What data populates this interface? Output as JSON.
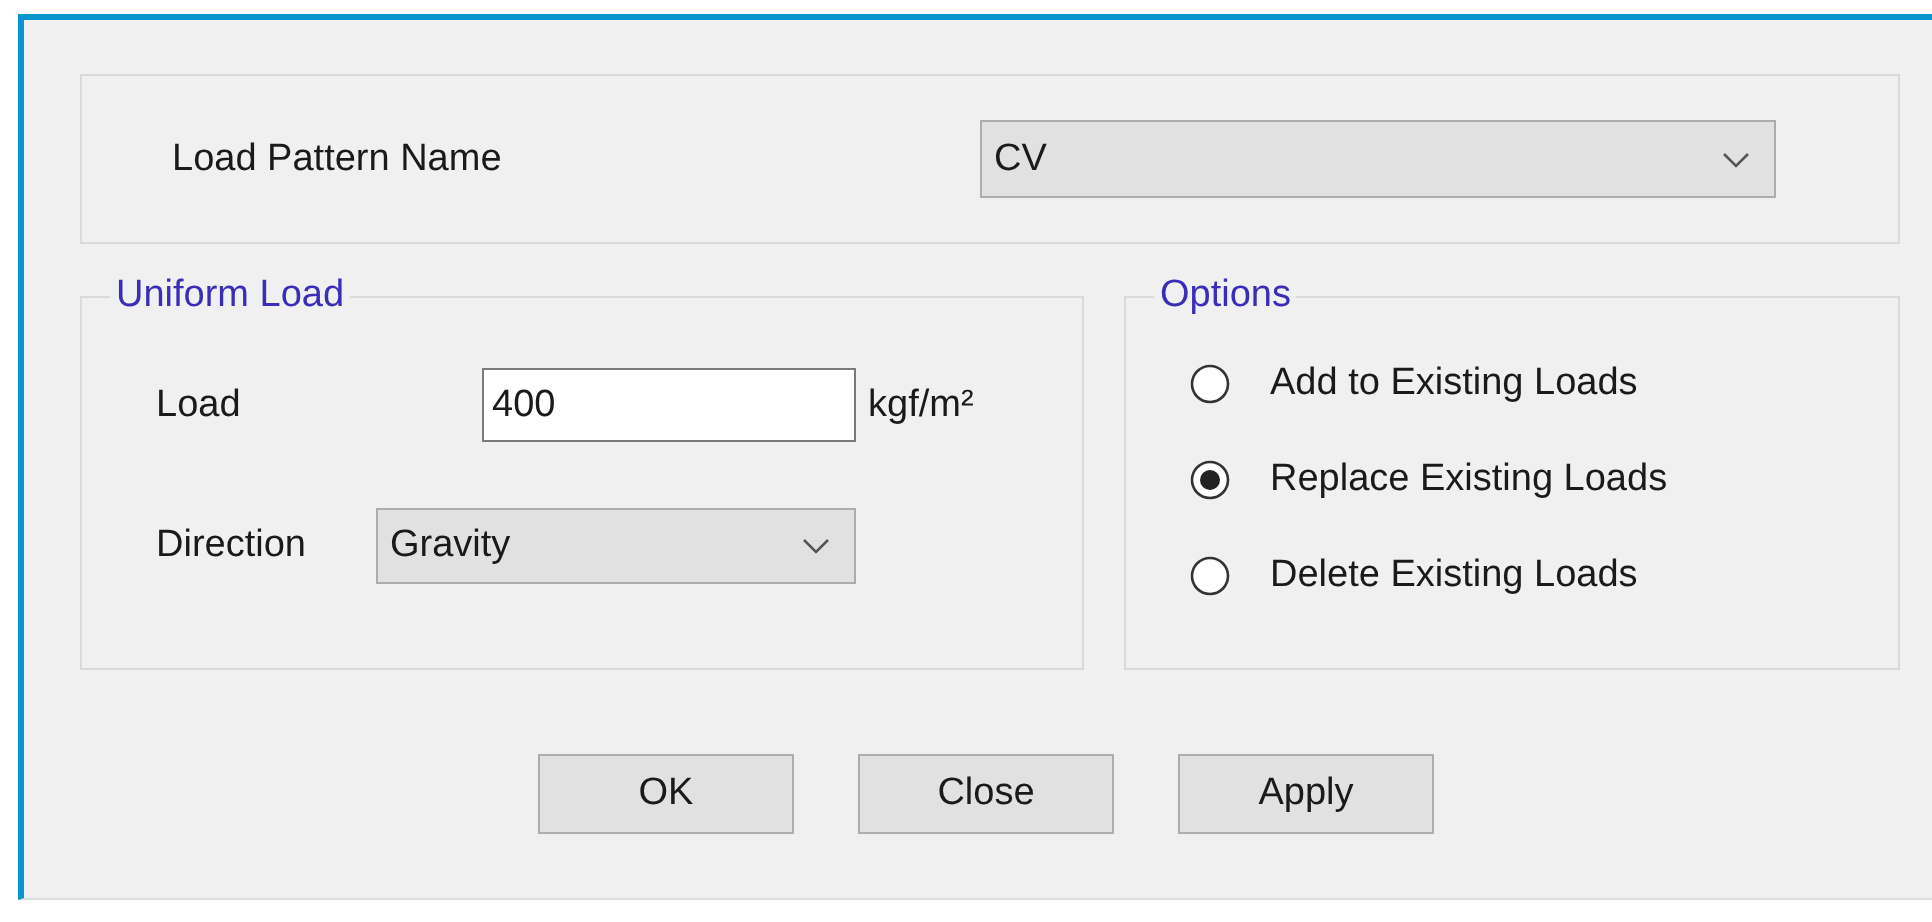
{
  "load_pattern": {
    "label": "Load Pattern Name",
    "value": "CV"
  },
  "uniform_load": {
    "title": "Uniform Load",
    "load_label": "Load",
    "load_value": "400",
    "unit": "kgf/m²",
    "direction_label": "Direction",
    "direction_value": "Gravity"
  },
  "options": {
    "title": "Options",
    "items": [
      {
        "label": "Add to Existing Loads",
        "selected": false
      },
      {
        "label": "Replace Existing Loads",
        "selected": true
      },
      {
        "label": "Delete Existing Loads",
        "selected": false
      }
    ]
  },
  "buttons": [
    "OK",
    "Close",
    "Apply"
  ]
}
